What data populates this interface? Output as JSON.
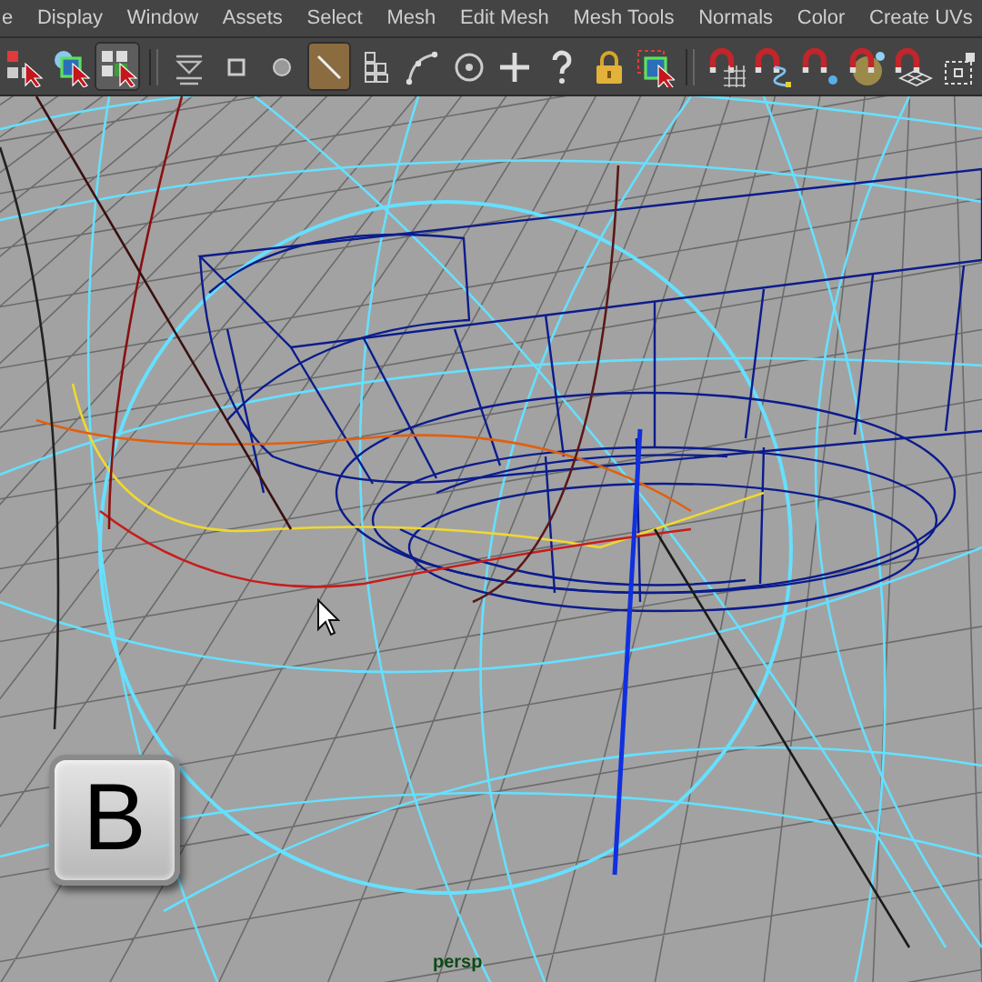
{
  "menu_bar": {
    "items": [
      "e",
      "Display",
      "Window",
      "Assets",
      "Select",
      "Mesh",
      "Edit Mesh",
      "Mesh Tools",
      "Normals",
      "Color",
      "Create UVs"
    ]
  },
  "toolbar": {
    "groups": [
      [
        {
          "kind": "hierarchy",
          "selected": false
        },
        {
          "kind": "object",
          "selected": false
        },
        {
          "kind": "component",
          "selected": true
        }
      ],
      [
        {
          "kind": "funnel",
          "selected": false
        },
        {
          "kind": "square",
          "selected": false
        },
        {
          "kind": "circle",
          "selected": false
        },
        {
          "kind": "line",
          "selected": true
        },
        {
          "kind": "blocks",
          "selected": false
        },
        {
          "kind": "curve",
          "selected": false
        },
        {
          "kind": "target",
          "selected": false
        },
        {
          "kind": "plus",
          "selected": false
        },
        {
          "kind": "question",
          "selected": false
        },
        {
          "kind": "lock",
          "selected": false
        },
        {
          "kind": "marquee",
          "selected": false
        }
      ],
      [
        {
          "kind": "snap-grid",
          "selected": false
        },
        {
          "kind": "snap-curve",
          "selected": false
        },
        {
          "kind": "snap-point",
          "selected": false
        },
        {
          "kind": "snap-surface",
          "selected": false
        },
        {
          "kind": "snap-plane",
          "selected": false
        },
        {
          "kind": "pivot",
          "selected": false
        }
      ]
    ]
  },
  "viewport": {
    "key": "B",
    "camera": "persp"
  }
}
